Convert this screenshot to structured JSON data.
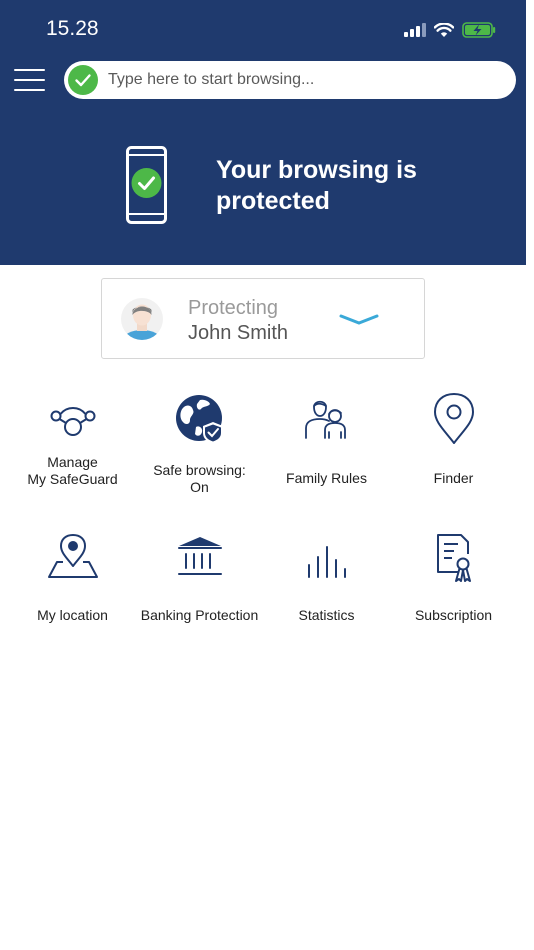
{
  "status_bar": {
    "time": "15.28"
  },
  "search": {
    "placeholder": "Type here to start browsing..."
  },
  "hero": {
    "message": "Your browsing is protected"
  },
  "profile": {
    "label": "Protecting",
    "name": "John Smith"
  },
  "tiles": [
    {
      "label": "Manage\nMy SafeGuard",
      "icon": "devices-network-icon"
    },
    {
      "label": "Safe browsing:\nOn",
      "icon": "globe-shield-icon"
    },
    {
      "label": "Family Rules",
      "icon": "family-icon"
    },
    {
      "label": "Finder",
      "icon": "map-pin-icon"
    },
    {
      "label": "My location",
      "icon": "location-map-icon"
    },
    {
      "label": "Banking Protection",
      "icon": "bank-icon"
    },
    {
      "label": "Statistics",
      "icon": "bar-chart-icon"
    },
    {
      "label": "Subscription",
      "icon": "certificate-icon"
    }
  ],
  "colors": {
    "header": "#1f3a6e",
    "accent": "#4db848",
    "icon": "#1f3a6e",
    "chevron": "#3aa9d8"
  }
}
